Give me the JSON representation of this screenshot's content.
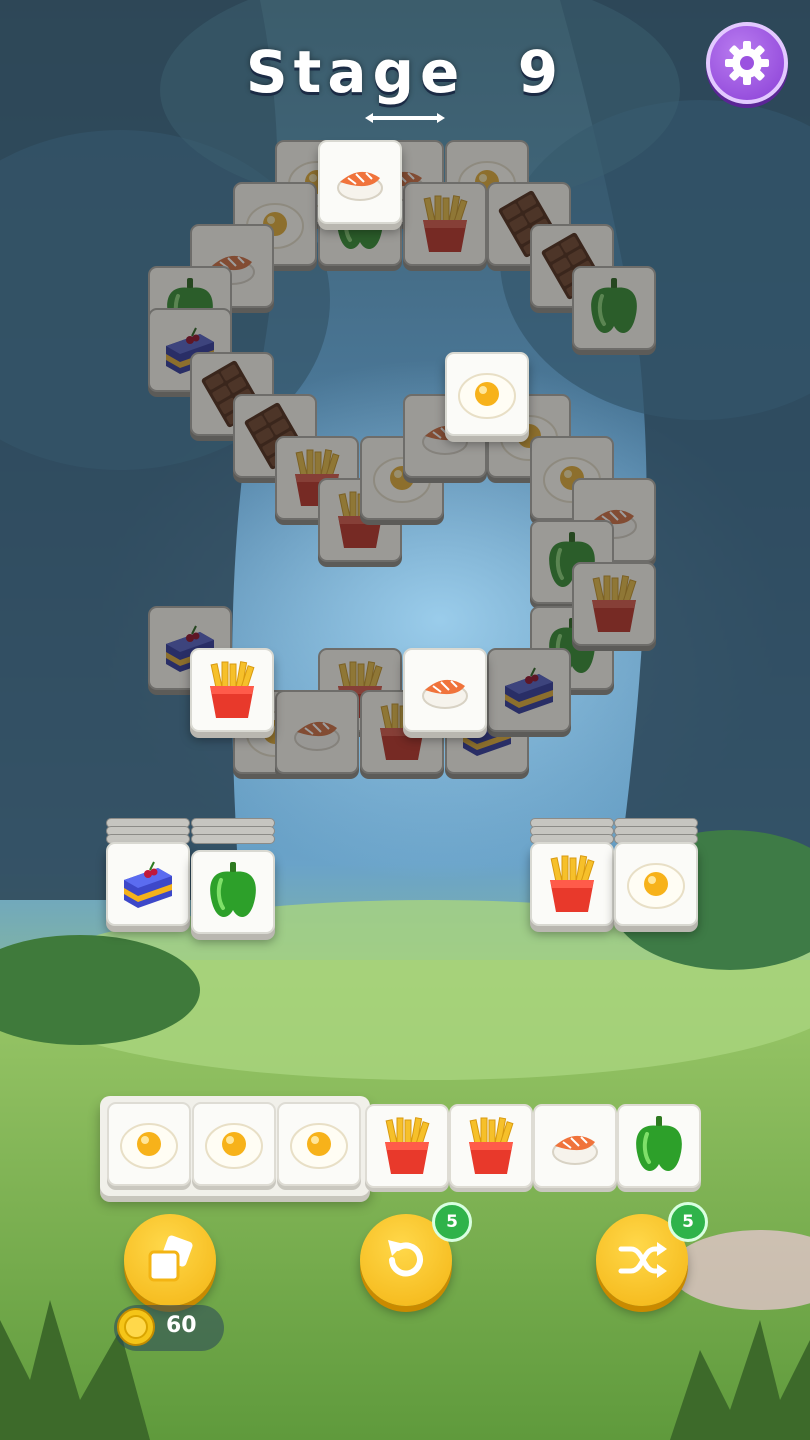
{
  "stage": {
    "label": "Stage",
    "number": "9"
  },
  "settings_icon": "gear-icon",
  "colors": {
    "accent_purple": "#8a3fd6",
    "button_yellow": "#f3b413",
    "badge_green": "#2fb34a",
    "tile_face": "#fbfbf8",
    "tile_blocked": "#9b9a96"
  },
  "tile_types": [
    "egg",
    "salmon",
    "fries",
    "pepper",
    "chocolate",
    "cake"
  ],
  "board_tiles": [
    {
      "id": 1,
      "type": "egg",
      "state": "blocked"
    },
    {
      "id": 2,
      "type": "salmon",
      "state": "blocked"
    },
    {
      "id": 3,
      "type": "egg",
      "state": "blocked"
    },
    {
      "id": 4,
      "type": "egg",
      "state": "blocked"
    },
    {
      "id": 5,
      "type": "pepper",
      "state": "blocked"
    },
    {
      "id": 6,
      "type": "fries",
      "state": "blocked"
    },
    {
      "id": 7,
      "type": "chocolate",
      "state": "blocked"
    },
    {
      "id": 8,
      "type": "salmon",
      "state": "blocked"
    },
    {
      "id": 9,
      "type": "chocolate",
      "state": "blocked"
    },
    {
      "id": 10,
      "type": "pepper",
      "state": "blocked"
    },
    {
      "id": 11,
      "type": "pepper",
      "state": "blocked"
    },
    {
      "id": 12,
      "type": "cake",
      "state": "blocked"
    },
    {
      "id": 13,
      "type": "chocolate",
      "state": "blocked"
    },
    {
      "id": 14,
      "type": "chocolate",
      "state": "blocked"
    },
    {
      "id": 15,
      "type": "fries",
      "state": "blocked"
    },
    {
      "id": 16,
      "type": "fries",
      "state": "blocked"
    },
    {
      "id": 17,
      "type": "egg",
      "state": "blocked"
    },
    {
      "id": 18,
      "type": "salmon",
      "state": "blocked"
    },
    {
      "id": 19,
      "type": "egg",
      "state": "blocked"
    },
    {
      "id": 20,
      "type": "egg",
      "state": "blocked"
    },
    {
      "id": 21,
      "type": "salmon",
      "state": "blocked"
    },
    {
      "id": 22,
      "type": "pepper",
      "state": "blocked"
    },
    {
      "id": 23,
      "type": "cake",
      "state": "blocked"
    },
    {
      "id": 24,
      "type": "pepper",
      "state": "blocked"
    },
    {
      "id": 25,
      "type": "fries",
      "state": "blocked"
    },
    {
      "id": 26,
      "type": "cake",
      "state": "blocked"
    },
    {
      "id": 27,
      "type": "fries",
      "state": "blocked"
    },
    {
      "id": 28,
      "type": "egg",
      "state": "blocked"
    },
    {
      "id": 29,
      "type": "salmon",
      "state": "blocked"
    },
    {
      "id": 30,
      "type": "fries",
      "state": "blocked"
    },
    {
      "id": 31,
      "type": "cake",
      "state": "blocked"
    },
    {
      "id": 32,
      "type": "cake",
      "state": "blocked"
    },
    {
      "id": 33,
      "type": "salmon",
      "state": "open"
    },
    {
      "id": 34,
      "type": "egg",
      "state": "open"
    },
    {
      "id": 35,
      "type": "fries",
      "state": "open"
    },
    {
      "id": 36,
      "type": "salmon",
      "state": "open"
    }
  ],
  "side_stacks": [
    {
      "type": "cake"
    },
    {
      "type": "pepper"
    },
    {
      "type": "fries"
    },
    {
      "type": "egg"
    }
  ],
  "tray": {
    "matched_group": [
      "egg",
      "egg",
      "egg"
    ],
    "slots": [
      "fries",
      "fries",
      "salmon",
      "pepper"
    ]
  },
  "powerups": {
    "flip": {
      "icon": "cards-icon"
    },
    "undo": {
      "icon": "undo-icon",
      "count": "5"
    },
    "shuffle": {
      "icon": "shuffle-icon",
      "count": "5"
    }
  },
  "coins": {
    "icon": "coin-icon",
    "count": "60"
  }
}
